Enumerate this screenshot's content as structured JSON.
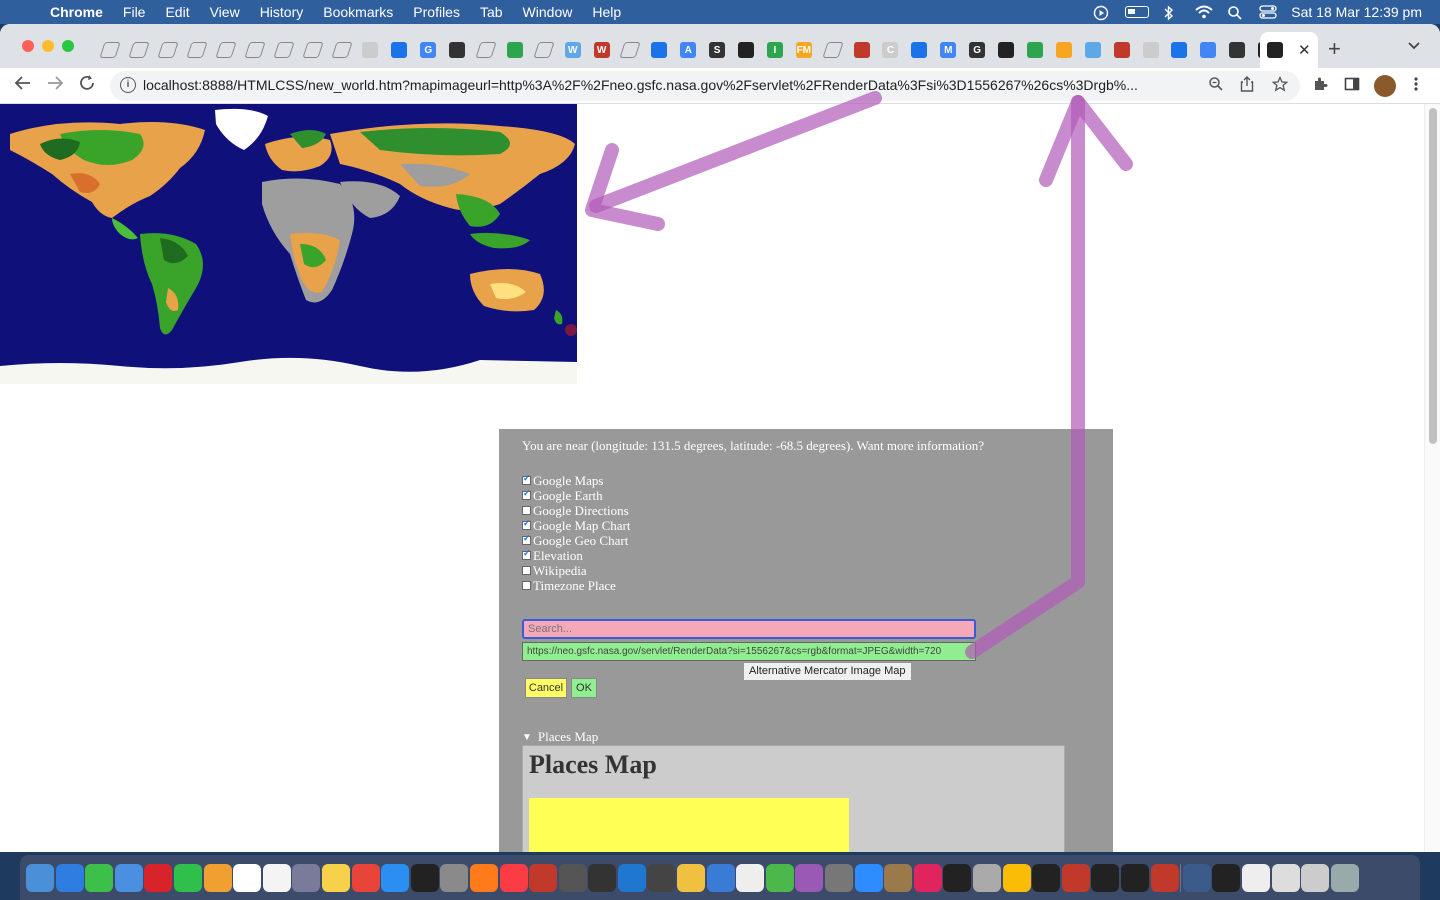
{
  "menubar": {
    "app_name": "Chrome",
    "menus": [
      "File",
      "Edit",
      "View",
      "History",
      "Bookmarks",
      "Profiles",
      "Tab",
      "Window",
      "Help"
    ],
    "clock": "Sat 18 Mar  12:39 pm",
    "tray_icons": [
      "play-icon",
      "battery-icon",
      "bluetooth-icon",
      "wifi-icon",
      "spotlight-icon",
      "control-center-icon"
    ]
  },
  "browser": {
    "url": "localhost:8888/HTMLCSS/new_world.htm?mapimageurl=http%3A%2F%2Fneo.gsfc.nasa.gov%2Fservlet%2FRenderData%3Fsi%3D1556267%26cs%3Drgb%...",
    "tab_favicons": [
      "feather",
      "feather",
      "feather",
      "feather",
      "feather",
      "feather",
      "feather",
      "feather",
      "feather",
      "globe",
      "globe",
      "G",
      "github",
      "feather",
      "doc",
      "feather",
      "W",
      "W",
      "feather",
      "blue-circle",
      "A",
      "S",
      "link",
      "I",
      "FM",
      "feather",
      "green",
      "C",
      "bracket",
      "M",
      "G",
      "compass",
      "link",
      "clock",
      "gear",
      "chrome",
      "Step",
      "compass",
      "Step",
      "link",
      "link",
      "dark"
    ],
    "active_tab_close": "✕",
    "new_tab": "+"
  },
  "dialog": {
    "message": "You are near (longitude: 131.5 degrees, latitude: -68.5 degrees). Want more information?",
    "options": [
      {
        "label": "Google Maps",
        "checked": true
      },
      {
        "label": "Google Earth",
        "checked": true
      },
      {
        "label": "Google Directions",
        "checked": false
      },
      {
        "label": "Google Map Chart",
        "checked": true
      },
      {
        "label": "Google Geo Chart",
        "checked": true
      },
      {
        "label": "Elevation",
        "checked": true
      },
      {
        "label": "Wikipedia",
        "checked": false
      },
      {
        "label": "Timezone Place",
        "checked": false
      }
    ],
    "search_placeholder": "Search...",
    "image_url_value": "https://neo.gsfc.nasa.gov/servlet/RenderData?si=1556267&cs=rgb&format=JPEG&width=720",
    "tooltip": "Alternative Mercator Image Map",
    "cancel_label": "Cancel",
    "ok_label": "OK",
    "places_summary": "Places Map",
    "places_heading": "Places Map"
  },
  "colors": {
    "ocean": "#10107a",
    "dialog_bg": "#999999",
    "search_bg": "#f4a8b8",
    "url_bg": "#90ee90",
    "cancel_bg": "#ffff66",
    "ok_bg": "#90ee90",
    "arrow": "#b05ab8"
  },
  "dock_icons": [
    "finder",
    "safari",
    "messages",
    "mail",
    "opera",
    "facetime",
    "photos",
    "calendar",
    "reminders",
    "launchpad",
    "notes",
    "news",
    "app-store",
    "tv",
    "settings",
    "firefox",
    "music",
    "filezilla",
    "calculator",
    "bbedit",
    "xcode",
    "compass",
    "tableplus",
    "preview",
    "textedit",
    "maps",
    "podcasts",
    "script",
    "zoom",
    "disk",
    "intellij",
    "terminal",
    "quicktime",
    "chrome",
    "inkscape",
    "affinity",
    "terminal2",
    "terminal3",
    "filemerge",
    "separator",
    "downloads",
    "dock-app",
    "screenshot",
    "doc",
    "doc2",
    "trash"
  ]
}
